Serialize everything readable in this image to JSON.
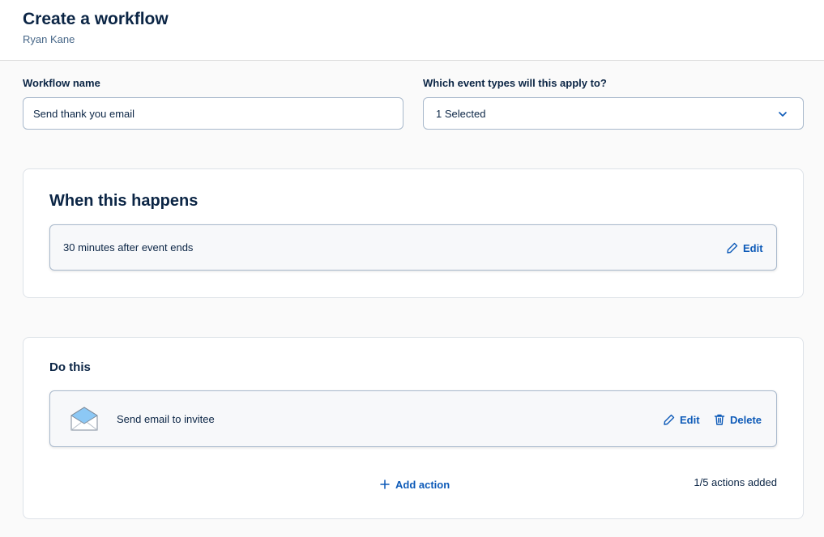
{
  "header": {
    "title": "Create a workflow",
    "owner": "Ryan Kane"
  },
  "form": {
    "name_label": "Workflow name",
    "name_value": "Send thank you email",
    "event_types_label": "Which event types will this apply to?",
    "event_types_selected": "1 Selected"
  },
  "trigger": {
    "title": "When this happens",
    "description": "30 minutes after event ends",
    "edit_label": "Edit"
  },
  "actions": {
    "title": "Do this",
    "items": [
      {
        "icon": "envelope-icon",
        "label": "Send email to invitee",
        "edit_label": "Edit",
        "delete_label": "Delete"
      }
    ],
    "add_label": "Add action",
    "count_text": "1/5 actions added"
  },
  "colors": {
    "accent": "#0d5ab8",
    "text": "#0b2545",
    "muted": "#476788",
    "border": "#a9b9cc"
  }
}
